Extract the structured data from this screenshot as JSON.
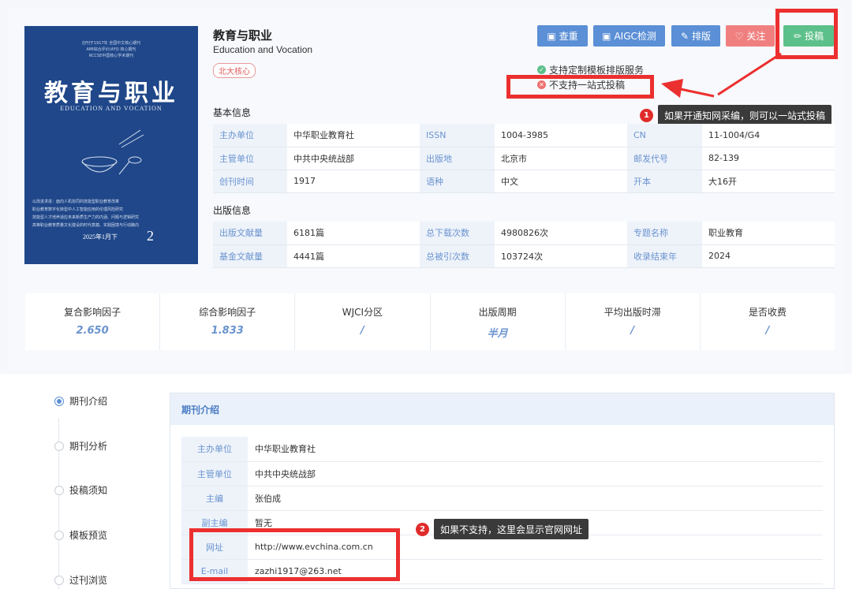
{
  "journal": {
    "title": "教育与职业",
    "title_en": "Education and Vocation",
    "tag": "北大核心"
  },
  "cover": {
    "top_lines": [
      "创刊于1917年  全国中文核心期刊",
      "AMI综合评价(A刊)  核心期刊",
      "RCCSE中国核心学术期刊"
    ],
    "title": "教育与职业",
    "subtitle": "EDUCATION AND VOCATION",
    "text_lines": [
      "以改进求进：面向人机协同的技能型职业教育改革",
      "职业教育数字化转型中人工智能应用的伦理风险研究",
      "技能型人才培养适应未来新质生产力的内涵、问题与逻辑研究",
      "高等职业教育质量文化建设的时代意蕴、实践困境与行动路向"
    ],
    "date": "2025年1月下",
    "issue": "2"
  },
  "buttons": [
    {
      "label": "查重",
      "icon": "check-doc-icon"
    },
    {
      "label": "AIGC检测",
      "icon": "aigc-doc-icon"
    },
    {
      "label": "排版",
      "icon": "edit-icon"
    },
    {
      "label": "关注",
      "icon": "heart-icon"
    },
    {
      "label": "投稿",
      "icon": "pen-icon"
    }
  ],
  "services": [
    {
      "label": "支持定制模板排版服务",
      "status": "supported",
      "color": "#5cc08a"
    },
    {
      "label": "不支持一站式投稿",
      "status": "unsupported",
      "color": "#f07070"
    }
  ],
  "callouts": [
    {
      "num": "1",
      "text": "如果开通知网采编，则可以一站式投稿"
    },
    {
      "num": "2",
      "text": "如果不支持，这里会显示官网网址"
    }
  ],
  "basic_info": {
    "title": "基本信息",
    "rows": [
      [
        {
          "k": "主办单位",
          "v": "中华职业教育社"
        },
        {
          "k": "ISSN",
          "v": "1004-3985"
        },
        {
          "k": "CN",
          "v": "11-1004/G4"
        }
      ],
      [
        {
          "k": "主管单位",
          "v": "中共中央统战部"
        },
        {
          "k": "出版地",
          "v": "北京市"
        },
        {
          "k": "邮发代号",
          "v": "82-139"
        }
      ],
      [
        {
          "k": "创刊时间",
          "v": "1917"
        },
        {
          "k": "语种",
          "v": "中文"
        },
        {
          "k": "开本",
          "v": "大16开"
        }
      ]
    ]
  },
  "publish_info": {
    "title": "出版信息",
    "rows": [
      [
        {
          "k": "出版文献量",
          "v": "6181篇"
        },
        {
          "k": "总下载次数",
          "v": "4980826次"
        },
        {
          "k": "专题名称",
          "v": "职业教育"
        }
      ],
      [
        {
          "k": "基金文献量",
          "v": "4441篇"
        },
        {
          "k": "总被引次数",
          "v": "103724次"
        },
        {
          "k": "收录结束年",
          "v": "2024"
        }
      ]
    ]
  },
  "metrics": [
    {
      "label": "复合影响因子",
      "value": "2.650"
    },
    {
      "label": "综合影响因子",
      "value": "1.833"
    },
    {
      "label": "WJCI分区",
      "value": "/"
    },
    {
      "label": "出版周期",
      "value": "半月"
    },
    {
      "label": "平均出版时滞",
      "value": "/"
    },
    {
      "label": "是否收费",
      "value": "/"
    }
  ],
  "sidebar": [
    {
      "label": "期刊介绍",
      "active": true
    },
    {
      "label": "期刊分析",
      "active": false
    },
    {
      "label": "投稿须知",
      "active": false
    },
    {
      "label": "模板预览",
      "active": false
    },
    {
      "label": "过刊浏览",
      "active": false
    }
  ],
  "panel": {
    "title": "期刊介绍",
    "rows": [
      {
        "k": "主办单位",
        "v": "中华职业教育社"
      },
      {
        "k": "主管单位",
        "v": "中共中央统战部"
      },
      {
        "k": "主编",
        "v": "张伯成"
      },
      {
        "k": "副主编",
        "v": "暂无"
      },
      {
        "k": "网址",
        "v": "http://www.evchina.com.cn"
      },
      {
        "k": "E-mail",
        "v": "zazhi1917@263.net"
      }
    ]
  }
}
